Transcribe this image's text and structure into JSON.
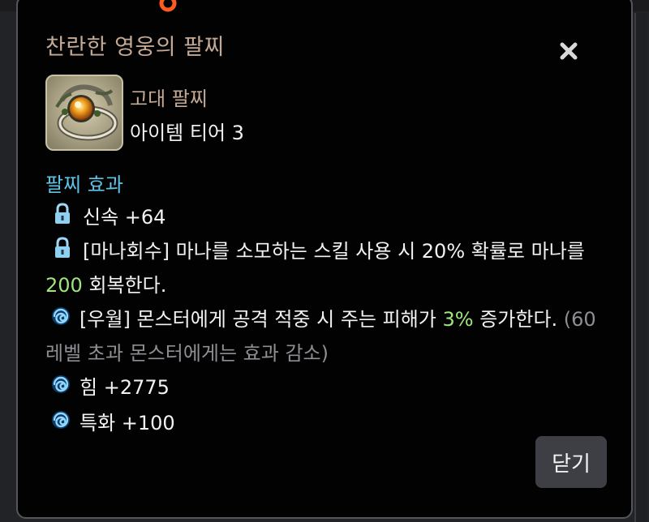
{
  "dialog": {
    "title": "찬란한 영웅의 팔찌",
    "close_icon": "close-icon",
    "close_button_label": "닫기"
  },
  "item": {
    "icon": "bracelet-icon",
    "grade": "고대 팔찌",
    "tier": "아이템 티어 3"
  },
  "effects": {
    "section_title": "팔찌 효과",
    "lines": [
      {
        "icon": "lock-icon",
        "text": "신속 +64"
      },
      {
        "icon": "lock-icon",
        "part1": "[마나회수] 마나를 소모하는 스킬 사용 시 20% 확률로 마나를",
        "value": "200",
        "part2": " 회복한다."
      },
      {
        "icon": "swirl-icon",
        "part1": "[우월] 몬스터에게 공격 적중 시 주는 피해가 ",
        "value": "3%",
        "part2": " 증가한다. ",
        "note1": "(60",
        "note2": "레벨 초과 몬스터에게는 효과 감소)"
      },
      {
        "icon": "swirl-icon",
        "text": "힘 +2775"
      },
      {
        "icon": "swirl-icon",
        "text": "특화 +100"
      }
    ]
  },
  "colors": {
    "title": "#c4a995",
    "section": "#5ec3e6",
    "highlight": "#9fe67c",
    "note": "#8e8e93",
    "accent_ring": "#ff5a1f"
  }
}
